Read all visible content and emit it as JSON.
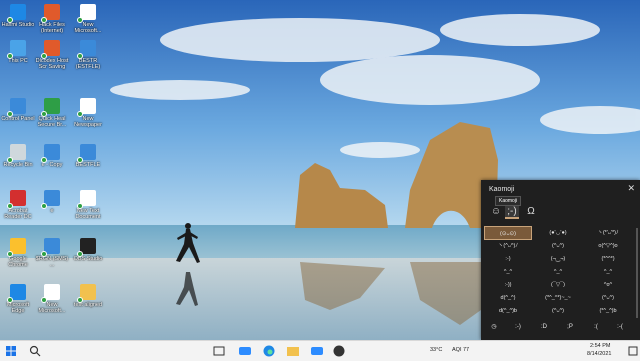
{
  "desktop": {
    "icons": [
      {
        "label": "Haxmi Studio",
        "color": "#1e88e5"
      },
      {
        "label": "Hack Files (Internet)",
        "color": "#e05a2b"
      },
      {
        "label": "New Microsoft...",
        "color": "#ffffff"
      },
      {
        "label": "This PC",
        "color": "#4aa3e8"
      },
      {
        "label": "Dlcodex Host Scr Saving",
        "color": "#e05a2b"
      },
      {
        "label": "BESTR (ESTFLE)",
        "color": "#3b8ad9"
      },
      {
        "label": "Control Panel",
        "color": "#3b8ad9"
      },
      {
        "label": "Quick Heal Secure Br...",
        "color": "#2e9e46"
      },
      {
        "label": "New Newspaper",
        "color": "#ffffff"
      },
      {
        "label": "Recycle Bin",
        "color": "#cfd8dc"
      },
      {
        "label": "e - Copy",
        "color": "#3b8ad9"
      },
      {
        "label": "BESTFLE",
        "color": "#3b8ad9"
      },
      {
        "label": "Acrobat Reader DC",
        "color": "#d32f2f"
      },
      {
        "label": "e",
        "color": "#3b8ad9"
      },
      {
        "label": "New Text Document",
        "color": "#ffffff"
      },
      {
        "label": "Google Chrome",
        "color": "#fbc02d"
      },
      {
        "label": "$RGN (SMS) ...",
        "color": "#3b8ad9"
      },
      {
        "label": "OBS Studio",
        "color": "#222222"
      },
      {
        "label": "Microsoft Edge",
        "color": "#1e88e5"
      },
      {
        "label": "New Microsoft...",
        "color": "#ffffff"
      },
      {
        "label": "test aligned",
        "color": "#f2c14e"
      }
    ]
  },
  "emoji_panel": {
    "title": "Kaomoji",
    "close_label": "✕",
    "tooltip": "Kaomoji",
    "categories": [
      {
        "icon": "☺",
        "name": "emoji-tab"
      },
      {
        "icon": ";-)",
        "name": "kaomoji-tab"
      },
      {
        "icon": "Ω",
        "name": "symbols-tab"
      }
    ],
    "kaomoji": [
      "(⊙ᴗ⊙)",
      "(●'◡'●)",
      "ヽ(*'ᴗ'*)ﾉ",
      "ヽ(^ᴗ^)ﾉ",
      "(^ᴗ^)",
      "o(^▽^)o",
      ":-)",
      "(¬‿¬)",
      "(*^^*)",
      "^_^",
      "^_^",
      "^_^",
      ":-))",
      "(¯▽¯)",
      "^o^",
      "d(^_^)",
      "(*^_^*)~_~",
      "(^ᴗ^)",
      "d(^_^)b",
      "(^ᴗ^)",
      "(*^_^)b"
    ],
    "bottom": [
      ":-)",
      ":D",
      ";P",
      ":(",
      ":-("
    ],
    "recent_icon": "clock-icon"
  },
  "taskbar": {
    "weather": "33°C",
    "aqi": "AQI 77",
    "time": "2:54 PM",
    "date": "8/14/2021",
    "apps": [
      "search",
      "task-view",
      "zoom",
      "edge",
      "file-explorer",
      "zoom2",
      "store",
      "obs",
      "chrome",
      "mail",
      "photos",
      "teams",
      "app"
    ]
  },
  "colors": {
    "panel_bg": "#1f1f1f",
    "selected": "#7a5a3a",
    "taskbar_bg": "#f3f3f3"
  }
}
